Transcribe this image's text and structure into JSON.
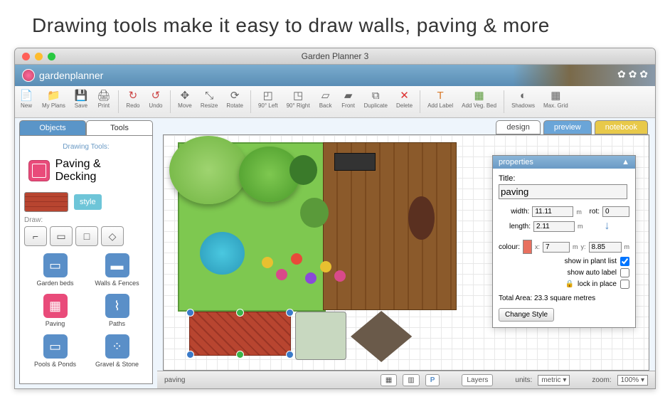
{
  "headline": "Drawing tools make it easy to draw walls, paving & more",
  "window": {
    "title": "Garden Planner 3"
  },
  "brand": {
    "name": "gardenplanner"
  },
  "toolbar": [
    {
      "label": "New",
      "icon": "📄"
    },
    {
      "label": "My Plans",
      "icon": "📁"
    },
    {
      "label": "Save",
      "icon": "💾"
    },
    {
      "label": "Print",
      "icon": "🖨"
    },
    null,
    {
      "label": "Redo",
      "icon": "↻",
      "color": "#c44"
    },
    {
      "label": "Undo",
      "icon": "↺",
      "color": "#c44"
    },
    null,
    {
      "label": "Move",
      "icon": "✥"
    },
    {
      "label": "Resize",
      "icon": "⤡"
    },
    {
      "label": "Rotate",
      "icon": "⟳"
    },
    null,
    {
      "label": "90° Left",
      "icon": "◰"
    },
    {
      "label": "90° Right",
      "icon": "◳"
    },
    {
      "label": "Back",
      "icon": "▱"
    },
    {
      "label": "Front",
      "icon": "▰"
    },
    {
      "label": "Duplicate",
      "icon": "⧉"
    },
    {
      "label": "Delete",
      "icon": "✕",
      "color": "#d33"
    },
    null,
    {
      "label": "Add Label",
      "icon": "T",
      "color": "#d87a2a"
    },
    {
      "label": "Add Veg. Bed",
      "icon": "▦",
      "color": "#5a9a3a"
    },
    null,
    {
      "label": "Shadows",
      "icon": "◐"
    },
    {
      "label": "Max. Grid",
      "icon": "▦"
    }
  ],
  "sidebar": {
    "tabs": [
      "Objects",
      "Tools"
    ],
    "active_tab": 1,
    "section_label": "Drawing Tools:",
    "current_tool": "Paving & Decking",
    "style_label": "style",
    "draw_label": "Draw:",
    "draw_modes": [
      "⌐",
      "▭",
      "□",
      "◇"
    ],
    "categories": [
      {
        "label": "Garden beds",
        "bg": "#5a8fc8",
        "icon": "▭"
      },
      {
        "label": "Walls & Fences",
        "bg": "#5a8fc8",
        "icon": "▬"
      },
      {
        "label": "Paving",
        "bg": "#e94b7a",
        "icon": "▦"
      },
      {
        "label": "Paths",
        "bg": "#5a8fc8",
        "icon": "⌇"
      },
      {
        "label": "Pools & Ponds",
        "bg": "#5a8fc8",
        "icon": "▭"
      },
      {
        "label": "Gravel & Stone",
        "bg": "#5a8fc8",
        "icon": "⁘"
      }
    ]
  },
  "viewtabs": [
    "design",
    "preview",
    "notebook"
  ],
  "properties": {
    "header": "properties",
    "title_label": "Title:",
    "title_value": "paving",
    "width_label": "width:",
    "width_value": "11.11",
    "rot_label": "rot:",
    "rot_value": "0",
    "length_label": "length:",
    "length_value": "2.11",
    "colour_label": "colour:",
    "x_label": "x:",
    "x_value": "7",
    "y_label": "y:",
    "y_value": "8.85",
    "m": "m",
    "show_plant": "show in plant list",
    "show_plant_chk": true,
    "show_auto": "show auto label",
    "show_auto_chk": false,
    "lock": "lock in place",
    "lock_chk": false,
    "total_area": "Total Area: 23.3 square metres",
    "change_style": "Change Style"
  },
  "status": {
    "selection": "paving",
    "layers": "Layers",
    "units_label": "units:",
    "units_value": "metric",
    "zoom_label": "zoom:",
    "zoom_value": "100%",
    "grid_buttons": [
      "▦",
      "▥",
      "P"
    ]
  }
}
